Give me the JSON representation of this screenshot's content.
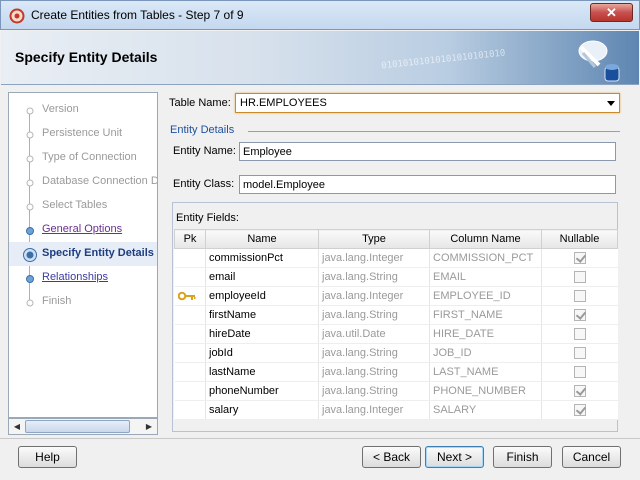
{
  "window": {
    "title": "Create Entities from Tables - Step 7 of 9",
    "close_glyph": "✕"
  },
  "header": {
    "title": "Specify Entity Details",
    "decoration": "01010101010101010101010"
  },
  "steps": [
    {
      "label": "Version",
      "state": "disabled"
    },
    {
      "label": "Persistence Unit",
      "state": "disabled"
    },
    {
      "label": "Type of Connection",
      "state": "disabled"
    },
    {
      "label": "Database Connection De",
      "state": "disabled"
    },
    {
      "label": "Select Tables",
      "state": "disabled"
    },
    {
      "label": "General Options",
      "state": "visited"
    },
    {
      "label": "Specify Entity Details",
      "state": "active"
    },
    {
      "label": "Relationships",
      "state": "link"
    },
    {
      "label": "Finish",
      "state": "disabled"
    }
  ],
  "form": {
    "table_name_label": "Table Name:",
    "table_name_value": "HR.EMPLOYEES",
    "section_title": "Entity Details",
    "entity_name_label": "Entity Name:",
    "entity_name_value": "Employee",
    "entity_class_label": "Entity Class:",
    "entity_class_value": "model.Employee",
    "fields_caption": "Entity Fields:"
  },
  "fields_table": {
    "headers": [
      "Pk",
      "Name",
      "Type",
      "Column Name",
      "Nullable"
    ],
    "rows": [
      {
        "pk": false,
        "name": "commissionPct",
        "type": "java.lang.Integer",
        "column": "COMMISSION_PCT",
        "nullable": true
      },
      {
        "pk": false,
        "name": "email",
        "type": "java.lang.String",
        "column": "EMAIL",
        "nullable": false
      },
      {
        "pk": true,
        "name": "employeeId",
        "type": "java.lang.Integer",
        "column": "EMPLOYEE_ID",
        "nullable": false
      },
      {
        "pk": false,
        "name": "firstName",
        "type": "java.lang.String",
        "column": "FIRST_NAME",
        "nullable": true
      },
      {
        "pk": false,
        "name": "hireDate",
        "type": "java.util.Date",
        "column": "HIRE_DATE",
        "nullable": false
      },
      {
        "pk": false,
        "name": "jobId",
        "type": "java.lang.String",
        "column": "JOB_ID",
        "nullable": false
      },
      {
        "pk": false,
        "name": "lastName",
        "type": "java.lang.String",
        "column": "LAST_NAME",
        "nullable": false
      },
      {
        "pk": false,
        "name": "phoneNumber",
        "type": "java.lang.String",
        "column": "PHONE_NUMBER",
        "nullable": true
      },
      {
        "pk": false,
        "name": "salary",
        "type": "java.lang.Integer",
        "column": "SALARY",
        "nullable": true
      }
    ]
  },
  "buttons": {
    "help": "Help",
    "back": "< Back",
    "next": "Next >",
    "finish": "Finish",
    "cancel": "Cancel"
  },
  "colors": {
    "active_step": "#1d3d80",
    "section_title": "#1f4f9f",
    "key_icon": "#d9a21b"
  }
}
